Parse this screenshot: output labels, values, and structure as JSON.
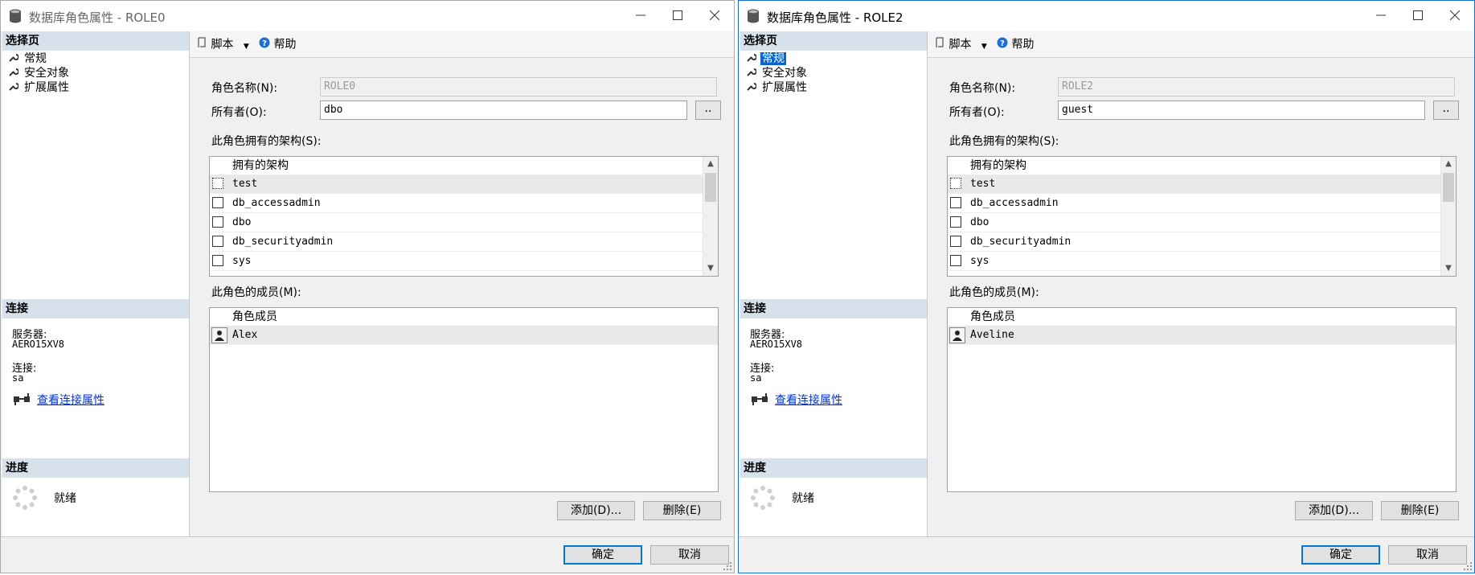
{
  "windows": [
    {
      "title": "数据库角色属性 - ROLE0",
      "nav_header": "选择页",
      "nav_items": [
        {
          "label": "常规",
          "selected": false
        },
        {
          "label": "安全对象",
          "selected": false
        },
        {
          "label": "扩展属性",
          "selected": false
        }
      ],
      "toolbar": {
        "script_label": "脚本",
        "help_label": "帮助"
      },
      "role_name_label": "角色名称(N):",
      "role_name_value": "ROLE0",
      "owner_label": "所有者(O):",
      "owner_value": "dbo",
      "browse_label": "..",
      "schemas_label": "此角色拥有的架构(S):",
      "schemas_header": "拥有的架构",
      "schemas": [
        "test",
        "db_accessadmin",
        "dbo",
        "db_securityadmin",
        "sys"
      ],
      "members_label": "此角色的成员(M):",
      "members_header": "角色成员",
      "members": [
        "Alex"
      ],
      "add_label": "添加(D)...",
      "remove_label": "删除(E)",
      "connection": {
        "header": "连接",
        "server_label": "服务器:",
        "server_value": "AERO15XV8",
        "conn_label": "连接:",
        "conn_value": "sa",
        "link_label": "查看连接属性"
      },
      "progress": {
        "header": "进度",
        "status": "就绪"
      },
      "ok_label": "确定",
      "cancel_label": "取消"
    },
    {
      "title": "数据库角色属性 - ROLE2",
      "nav_header": "选择页",
      "nav_items": [
        {
          "label": "常规",
          "selected": true
        },
        {
          "label": "安全对象",
          "selected": false
        },
        {
          "label": "扩展属性",
          "selected": false
        }
      ],
      "toolbar": {
        "script_label": "脚本",
        "help_label": "帮助"
      },
      "role_name_label": "角色名称(N):",
      "role_name_value": "ROLE2",
      "owner_label": "所有者(O):",
      "owner_value": "guest",
      "browse_label": "..",
      "schemas_label": "此角色拥有的架构(S):",
      "schemas_header": "拥有的架构",
      "schemas": [
        "test",
        "db_accessadmin",
        "dbo",
        "db_securityadmin",
        "sys"
      ],
      "members_label": "此角色的成员(M):",
      "members_header": "角色成员",
      "members": [
        "Aveline"
      ],
      "add_label": "添加(D)...",
      "remove_label": "删除(E)",
      "connection": {
        "header": "连接",
        "server_label": "服务器:",
        "server_value": "AERO15XV8",
        "conn_label": "连接:",
        "conn_value": "sa",
        "link_label": "查看连接属性"
      },
      "progress": {
        "header": "进度",
        "status": "就绪"
      },
      "ok_label": "确定",
      "cancel_label": "取消"
    }
  ]
}
